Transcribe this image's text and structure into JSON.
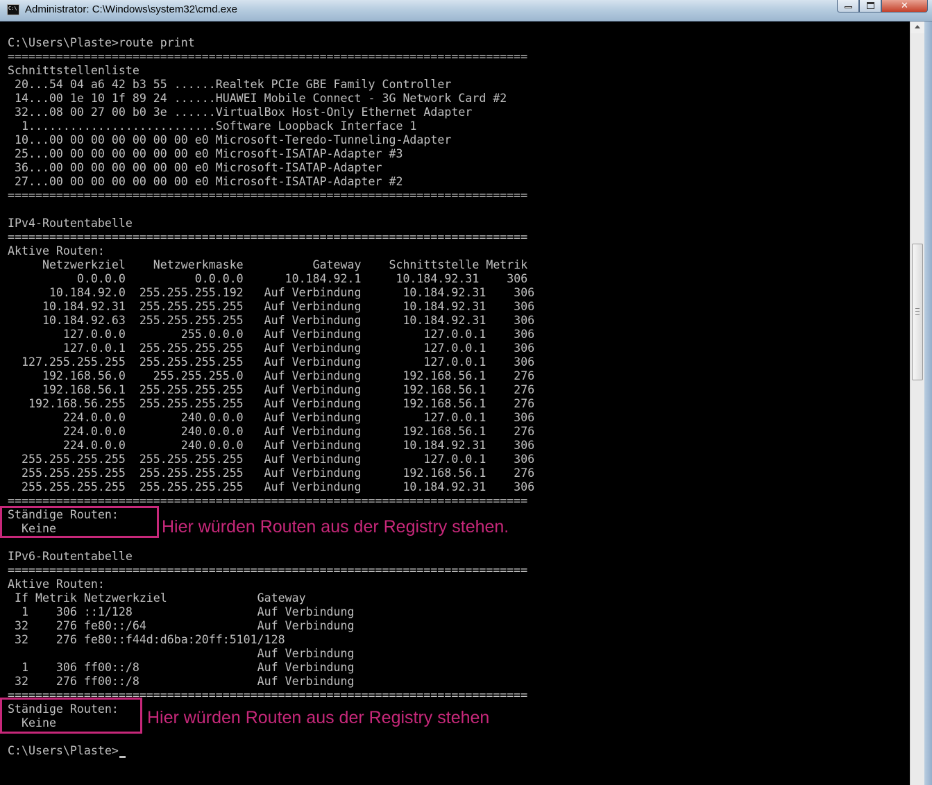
{
  "window": {
    "title": "Administrator: C:\\Windows\\system32\\cmd.exe",
    "close_glyph": "✕"
  },
  "console": {
    "lines": [
      "C:\\Users\\Plaste>route print",
      "===========================================================================",
      "Schnittstellenliste",
      " 20...54 04 a6 42 b3 55 ......Realtek PCIe GBE Family Controller",
      " 14...00 1e 10 1f 89 24 ......HUAWEI Mobile Connect - 3G Network Card #2",
      " 32...08 00 27 00 b0 3e ......VirtualBox Host-Only Ethernet Adapter",
      "  1...........................Software Loopback Interface 1",
      " 10...00 00 00 00 00 00 00 e0 Microsoft-Teredo-Tunneling-Adapter",
      " 25...00 00 00 00 00 00 00 e0 Microsoft-ISATAP-Adapter #3",
      " 36...00 00 00 00 00 00 00 e0 Microsoft-ISATAP-Adapter",
      " 27...00 00 00 00 00 00 00 e0 Microsoft-ISATAP-Adapter #2",
      "===========================================================================",
      "",
      "IPv4-Routentabelle",
      "===========================================================================",
      "Aktive Routen:",
      "     Netzwerkziel    Netzwerkmaske          Gateway    Schnittstelle Metrik",
      "          0.0.0.0          0.0.0.0      10.184.92.1     10.184.92.31    306",
      "      10.184.92.0  255.255.255.192   Auf Verbindung      10.184.92.31    306",
      "     10.184.92.31  255.255.255.255   Auf Verbindung      10.184.92.31    306",
      "     10.184.92.63  255.255.255.255   Auf Verbindung      10.184.92.31    306",
      "        127.0.0.0        255.0.0.0   Auf Verbindung         127.0.0.1    306",
      "        127.0.0.1  255.255.255.255   Auf Verbindung         127.0.0.1    306",
      "  127.255.255.255  255.255.255.255   Auf Verbindung         127.0.0.1    306",
      "     192.168.56.0    255.255.255.0   Auf Verbindung      192.168.56.1    276",
      "     192.168.56.1  255.255.255.255   Auf Verbindung      192.168.56.1    276",
      "   192.168.56.255  255.255.255.255   Auf Verbindung      192.168.56.1    276",
      "        224.0.0.0        240.0.0.0   Auf Verbindung         127.0.0.1    306",
      "        224.0.0.0        240.0.0.0   Auf Verbindung      192.168.56.1    276",
      "        224.0.0.0        240.0.0.0   Auf Verbindung      10.184.92.31    306",
      "  255.255.255.255  255.255.255.255   Auf Verbindung         127.0.0.1    306",
      "  255.255.255.255  255.255.255.255   Auf Verbindung      192.168.56.1    276",
      "  255.255.255.255  255.255.255.255   Auf Verbindung      10.184.92.31    306",
      "===========================================================================",
      "Ständige Routen:",
      "  Keine",
      "",
      "IPv6-Routentabelle",
      "===========================================================================",
      "Aktive Routen:",
      " If Metrik Netzwerkziel             Gateway",
      "  1    306 ::1/128                  Auf Verbindung",
      " 32    276 fe80::/64                Auf Verbindung",
      " 32    276 fe80::f44d:d6ba:20ff:5101/128",
      "                                    Auf Verbindung",
      "  1    306 ff00::/8                 Auf Verbindung",
      " 32    276 ff00::/8                 Auf Verbindung",
      "===========================================================================",
      "Ständige Routen:",
      "  Keine",
      "",
      "C:\\Users\\Plaste>"
    ]
  },
  "annotations": {
    "first": "Hier würden Routen aus der  Registry stehen.",
    "second": "Hier würden Routen aus der Registry stehen",
    "color": "#c7287a"
  }
}
